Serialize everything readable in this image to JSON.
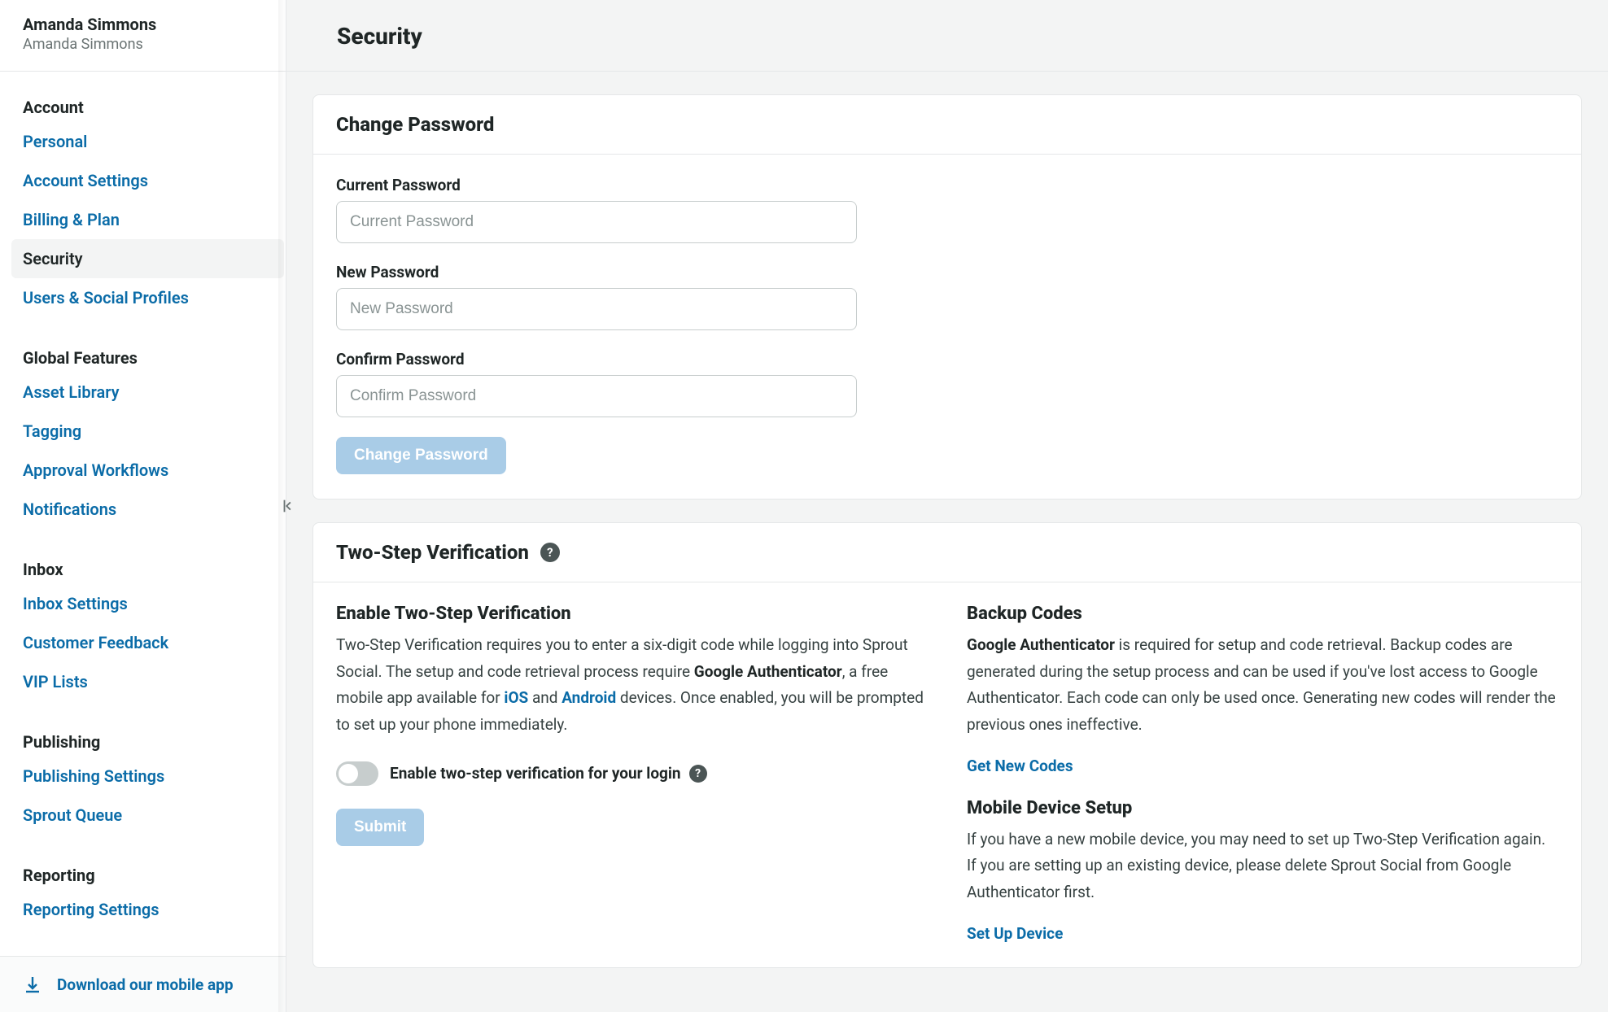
{
  "profile": {
    "name": "Amanda Simmons",
    "sub": "Amanda Simmons"
  },
  "sidebar": {
    "sections": [
      {
        "title": "Account",
        "items": [
          {
            "label": "Personal"
          },
          {
            "label": "Account Settings"
          },
          {
            "label": "Billing & Plan"
          },
          {
            "label": "Security",
            "active": true
          },
          {
            "label": "Users & Social Profiles"
          }
        ]
      },
      {
        "title": "Global Features",
        "items": [
          {
            "label": "Asset Library"
          },
          {
            "label": "Tagging"
          },
          {
            "label": "Approval Workflows"
          },
          {
            "label": "Notifications"
          }
        ]
      },
      {
        "title": "Inbox",
        "items": [
          {
            "label": "Inbox Settings"
          },
          {
            "label": "Customer Feedback"
          },
          {
            "label": "VIP Lists"
          }
        ]
      },
      {
        "title": "Publishing",
        "items": [
          {
            "label": "Publishing Settings"
          },
          {
            "label": "Sprout Queue"
          }
        ]
      },
      {
        "title": "Reporting",
        "items": [
          {
            "label": "Reporting Settings"
          }
        ]
      }
    ],
    "download": "Download our mobile app"
  },
  "page": {
    "title": "Security"
  },
  "change_password": {
    "heading": "Change Password",
    "current_label": "Current Password",
    "current_placeholder": "Current Password",
    "new_label": "New Password",
    "new_placeholder": "New Password",
    "confirm_label": "Confirm Password",
    "confirm_placeholder": "Confirm Password",
    "button": "Change Password"
  },
  "two_step": {
    "heading": "Two-Step Verification",
    "enable": {
      "heading": "Enable Two-Step Verification",
      "pre_text": "Two-Step Verification requires you to enter a six-digit code while logging into Sprout Social. The setup and code retrieval process require ",
      "ga_strong": "Google Authenticator",
      "mid_text": ", a free mobile app available for ",
      "ios_link": "iOS",
      "and_text": " and ",
      "android_link": "Android",
      "post_text": " devices. Once enabled, you will be prompted to set up your phone immediately.",
      "toggle_label": "Enable two-step verification for your login",
      "submit": "Submit"
    },
    "backup": {
      "heading": "Backup Codes",
      "ga_strong": "Google Authenticator",
      "text": " is required for setup and code retrieval. Backup codes are generated during the setup process and can be used if you've lost access to Google Authenticator. Each code can only be used once. Generating new codes will render the previous ones ineffective.",
      "get_codes": "Get New Codes"
    },
    "mobile": {
      "heading": "Mobile Device Setup",
      "text": "If you have a new mobile device, you may need to set up Two-Step Verification again. If you are setting up an existing device, please delete Sprout Social from Google Authenticator first.",
      "setup": "Set Up Device"
    }
  }
}
